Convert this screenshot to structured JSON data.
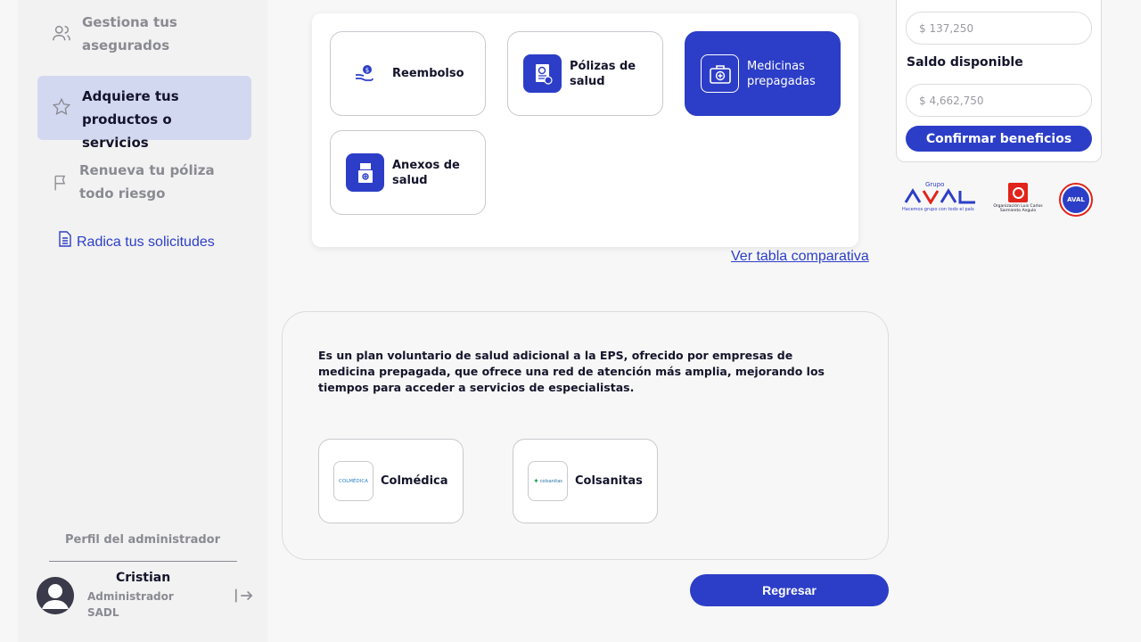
{
  "sidebar": {
    "items": [
      {
        "label": "Gestiona tus asegurados",
        "icon": "users-icon"
      },
      {
        "label": "Adquiere tus productos o servicios",
        "icon": "star-icon"
      },
      {
        "label": "Renueva tu póliza todo riesgo",
        "icon": "flag-icon"
      },
      {
        "label": "Radica tus solicitudes",
        "icon": "document-icon"
      }
    ],
    "admin_title": "Perfil del administrador",
    "user": {
      "name": "Cristian",
      "role": "Administrador SADL"
    }
  },
  "products": [
    {
      "label": "Reembolso",
      "icon": "refund-hand-icon"
    },
    {
      "label": "Pólizas de salud",
      "icon": "health-policy-icon"
    },
    {
      "label": "Medicinas prepagadas",
      "icon": "medical-kit-icon",
      "active": true
    },
    {
      "label": "Anexos de salud",
      "icon": "health-annex-icon"
    }
  ],
  "compare_link": "Ver tabla comparativa",
  "description": "Es un plan voluntario de salud adicional a la EPS, ofrecido por empresas de medicina prepagada, que ofrece una red de atención más amplia, mejorando los tiempos para acceder a servicios de especialistas.",
  "providers": [
    {
      "label": "Colmédica",
      "logo_text": "COLMÉDICA"
    },
    {
      "label": "Colsanitas",
      "logo_text": "colsanitas"
    }
  ],
  "back_button": "Regresar",
  "balance": {
    "top_value": "$ 137,250",
    "saldo_label": "Saldo disponible",
    "saldo_value": "$ 4,662,750",
    "confirm_button": "Confirmar beneficios"
  },
  "logos": {
    "aval_top": "Grupo",
    "aval_main": "AVAL",
    "aval_tagline": "Hacemos grupo con todo el país",
    "olcsa": "Organización Luis Carlos Sarmiento Angulo",
    "seal": "AVAL"
  },
  "colors": {
    "accent": "#2c3ec7",
    "active_nav": "#d3d8f1"
  }
}
